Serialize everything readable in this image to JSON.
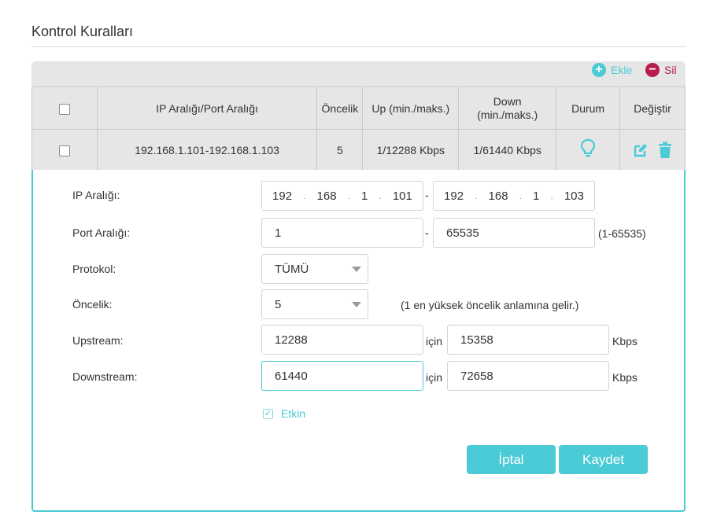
{
  "page": {
    "title": "Kontrol Kuralları"
  },
  "toolbar": {
    "add_label": "Ekle",
    "delete_label": "Sil",
    "add_symbol": "+",
    "delete_symbol": "−"
  },
  "table": {
    "headers": [
      "IP Aralığı/Port Aralığı",
      "Öncelik",
      "Up (min./maks.)",
      "Down\n(min./maks.)",
      "Durum",
      "Değiştir"
    ],
    "rows": [
      {
        "range": "192.168.1.101-192.168.1.103",
        "priority": "5",
        "up": "1/12288 Kbps",
        "down": "1/61440 Kbps",
        "status_icon": "lightbulb-icon",
        "actions": [
          "edit-icon",
          "trash-icon"
        ]
      }
    ]
  },
  "form": {
    "ip_range_label": "IP Aralığı:",
    "ip_start": [
      "192",
      "168",
      "1",
      "101"
    ],
    "ip_end": [
      "192",
      "168",
      "1",
      "103"
    ],
    "ip_sep": "-",
    "port_range_label": "Port Aralığı:",
    "port_start": "1",
    "port_end": "65535",
    "port_sep": "-",
    "port_hint": "(1-65535)",
    "protocol_label": "Protokol:",
    "protocol_value": "TÜMÜ",
    "priority_label": "Öncelik:",
    "priority_value": "5",
    "priority_hint": "(1 en yüksek öncelik anlamına gelir.)",
    "upstream_label": "Upstream:",
    "upstream_min": "12288",
    "upstream_max": "15358",
    "downstream_label": "Downstream:",
    "downstream_min": "61440",
    "downstream_max": "72658",
    "for_text": "için",
    "unit": "Kbps",
    "enable_label": "Etkin",
    "enabled": true,
    "cancel_label": "İptal",
    "save_label": "Kaydet"
  },
  "colors": {
    "accent": "#4acbd6",
    "delete": "#b71c4a",
    "header_bg": "#e6e6e6"
  }
}
